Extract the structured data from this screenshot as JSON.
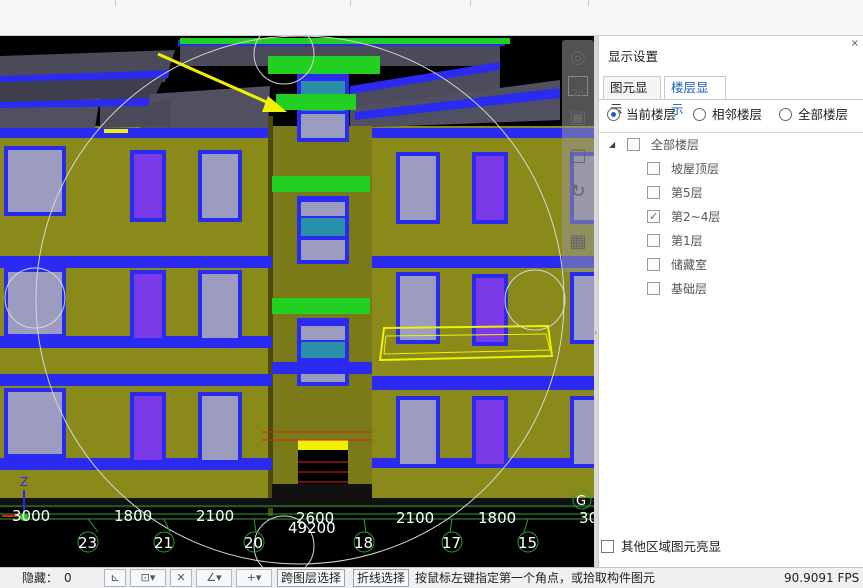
{
  "panel": {
    "title": "显示设置",
    "close": "×",
    "tabs": [
      "图元显示",
      "楼层显示"
    ],
    "radios": [
      "当前楼层",
      "相邻楼层",
      "全部楼层"
    ],
    "tree": {
      "root": "全部楼层",
      "items": [
        "坡屋顶层",
        "第5层",
        "第2~4层",
        "第1层",
        "储藏室",
        "基础层"
      ],
      "checked_item": "第2~4层"
    },
    "bottom_option": "其他区域图元亮显"
  },
  "viewport": {
    "dimensions": [
      "3000",
      "1800",
      "2100",
      "2600",
      "2100",
      "1800",
      "30"
    ],
    "total": "49200",
    "axes": [
      "23",
      "21",
      "20",
      "18",
      "17",
      "15"
    ],
    "axis_g": "G",
    "axis_z": "Z"
  },
  "nav": {
    "layer_num": "20"
  },
  "status": {
    "hidden_label": "隐藏：",
    "hidden_value": "0",
    "cross_layer_btn": "跨图层选择",
    "polyline_btn": "折线选择",
    "hint": "按鼠标左键指定第一个角点，或拾取构件图元",
    "fps": "90.9091 FPS"
  },
  "colors": {
    "wall": "#8a8a1a",
    "slab": "#2a2af0",
    "window": "#9c9cc0",
    "green": "#22d022",
    "highlight": "#f0f000",
    "accent": "#1a5fb4"
  }
}
